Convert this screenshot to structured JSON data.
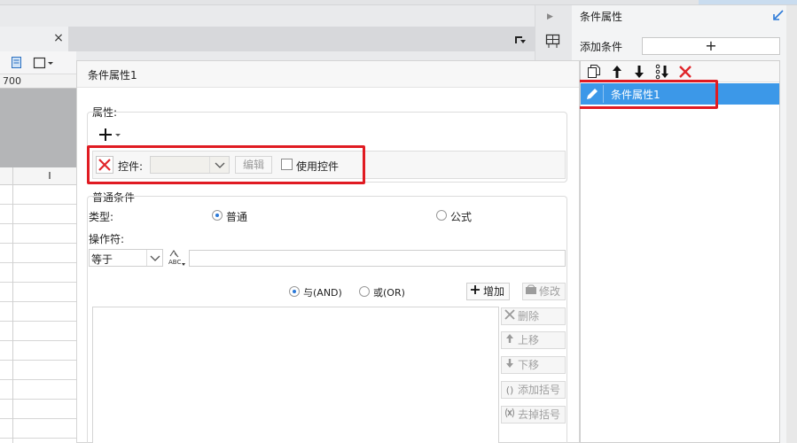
{
  "editor": {
    "ruler_label": "700",
    "sheet_header_label": "I",
    "tab_close": "×"
  },
  "right_panel": {
    "title": "条件属性",
    "add_condition_label": "添加条件",
    "add_button_symbol": "+",
    "toolbar_icons": [
      "copy-icon",
      "arrow-up-icon",
      "arrow-down-icon",
      "sort-icon",
      "delete-icon"
    ],
    "items": [
      {
        "label": "条件属性1",
        "selected": true
      }
    ]
  },
  "dialog": {
    "title": "条件属性1",
    "attributes_group_label": "属性:",
    "add_attr_symbol": "+",
    "control_label": "控件:",
    "edit_button": "编辑",
    "use_control_label": "使用控件",
    "normal_condition_label": "普通条件",
    "type_label": "类型:",
    "type_options": [
      "普通",
      "公式"
    ],
    "type_selected": "普通",
    "operator_label": "操作符:",
    "operator_value": "等于",
    "value_input": "",
    "logic_options": [
      "与(AND)",
      "或(OR)"
    ],
    "logic_selected": "与(AND)",
    "buttons": {
      "add": "增加",
      "modify": "修改",
      "delete": "删除",
      "move_up": "上移",
      "move_down": "下移",
      "add_bracket": "添加括号",
      "remove_bracket": "去掉括号"
    }
  },
  "colors": {
    "selection": "#3c98e8",
    "highlight_box": "#e01b22"
  }
}
